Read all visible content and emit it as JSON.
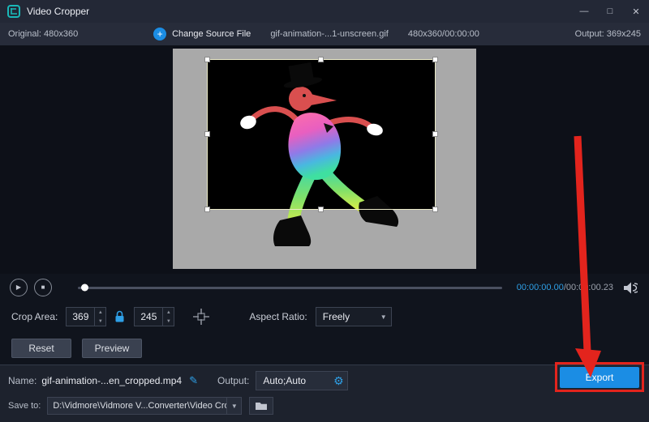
{
  "colors": {
    "accent_blue": "#1b8de4",
    "annotation_red": "#e3241d",
    "logo_teal": "#1ab8b8",
    "time_blue": "#2e9fe6"
  },
  "titlebar": {
    "app_title": "Video Cropper"
  },
  "infobar": {
    "original": "Original: 480x360",
    "change_source": "Change Source File",
    "filename": "gif-animation-...1-unscreen.gif",
    "file_info": "480x360/00:00:00",
    "output": "Output: 369x245"
  },
  "player": {
    "current_time": "00:00:00.00",
    "duration": "/00:00:00.23"
  },
  "crop": {
    "area_label": "Crop Area:",
    "width": "369",
    "height": "245",
    "aspect_label": "Aspect Ratio:",
    "aspect_value": "Freely"
  },
  "buttons": {
    "reset": "Reset",
    "preview": "Preview",
    "export": "Export"
  },
  "output_row": {
    "name_label": "Name:",
    "name_value": "gif-animation-...en_cropped.mp4",
    "output_label": "Output:",
    "output_value": "Auto;Auto"
  },
  "save_row": {
    "label": "Save to:",
    "path": "D:\\Vidmore\\Vidmore V...Converter\\Video Crop"
  },
  "icons": {
    "minimize": "—",
    "maximize": "□",
    "close": "✕",
    "plus": "+",
    "play": "▶",
    "stop": "■",
    "spin_up": "▲",
    "spin_down": "▼",
    "dropdown": "▼",
    "pencil": "✎",
    "gear": "⚙"
  }
}
